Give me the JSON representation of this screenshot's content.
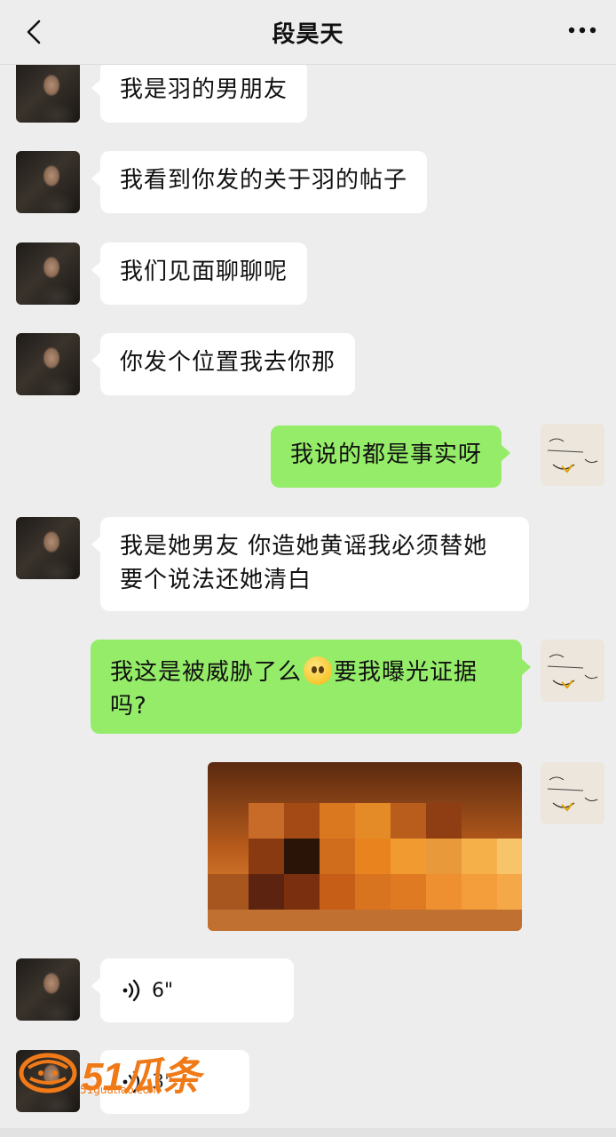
{
  "header": {
    "title": "段昊天",
    "back_icon": "chevron-left-icon",
    "more_icon": "more-dots-icon"
  },
  "messages": [
    {
      "side": "left",
      "text": "我是羽的男朋友"
    },
    {
      "side": "left",
      "text": "我看到你发的关于羽的帖子"
    },
    {
      "side": "left",
      "text": "我们见面聊聊呢"
    },
    {
      "side": "left",
      "text": "你发个位置我去你那"
    },
    {
      "side": "right",
      "text": "我说的都是事实呀"
    },
    {
      "side": "left",
      "text_line1": "我是她男友 你造她黄谣我必须替她",
      "text_line2": "要个说法还她清白"
    },
    {
      "side": "right",
      "text_part1": "我这是被威胁了么",
      "emoji": "pleading-face-emoji",
      "text_part2": "要我曝光证据",
      "text_line2": "吗?"
    },
    {
      "side": "right",
      "type": "image",
      "description_icon": "pixelated-photo"
    },
    {
      "side": "left",
      "type": "voice",
      "duration": "6\""
    },
    {
      "side": "left",
      "type": "voice",
      "duration": "3\""
    }
  ],
  "watermark": {
    "text": "51瓜条",
    "url": "51guatiao.com"
  },
  "colors": {
    "background": "#ededed",
    "bubble_left": "#ffffff",
    "bubble_right": "#95ec69",
    "watermark": "#f07a17"
  }
}
